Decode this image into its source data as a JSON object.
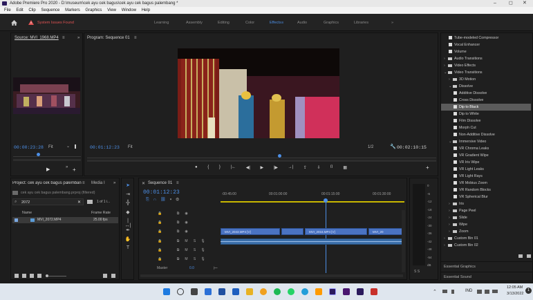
{
  "window": {
    "title": "Adobe Premiere Pro 2020 - D:\\museum\\cek ayu cek bagus\\cek ayu cek bagus palembang *",
    "controls": [
      "–",
      "◻",
      "✕"
    ]
  },
  "menu": [
    "File",
    "Edit",
    "Clip",
    "Sequence",
    "Markers",
    "Graphics",
    "View",
    "Window",
    "Help"
  ],
  "workspaces": [
    "Learning",
    "Assembly",
    "Editing",
    "Color",
    "Effects",
    "Audio",
    "Graphics",
    "Libraries"
  ],
  "workspace_active": "Effects",
  "workspace_more": "»",
  "issues_label": "System Issues Found",
  "source": {
    "tab": "Source: MVI_1968.MP4",
    "menu": "≡",
    "more": "»",
    "timecode": "00:00:23:28",
    "fit": "Fit",
    "fit_arrow": "⌄"
  },
  "program": {
    "tab": "Program: Sequence 01",
    "menu": "≡",
    "timecode": "00:01:12:23",
    "fit": "Fit",
    "fraction": "1/2",
    "duration": "00:02:10:15",
    "wrench": "🔧"
  },
  "program_controls": [
    "●",
    "{",
    "}",
    "|←",
    "◀|",
    "▶",
    "|▶",
    "→|",
    "⇪",
    "⇩",
    "⌷",
    "▦"
  ],
  "source_controls": [
    "▶",
    "»",
    "+"
  ],
  "program_plus": "+",
  "project": {
    "tab": "Project: cek ayu cek bagus palembang",
    "tab_menu": "≡",
    "media_tab": "Media I",
    "more": "»",
    "file": "cek ayu cek bagus palembang.prproj (filtered)",
    "search": "2072",
    "count": "1 of 1 i...",
    "col_name": "Name",
    "col_rate": "Frame Rate",
    "item_name": "MVI_2072.MP4",
    "item_rate": "25.00 fps"
  },
  "timeline": {
    "close": "✕",
    "tab": "Sequence 01",
    "menu": "≡",
    "timecode": "00:01:12:23",
    "ruler": [
      ":00:45:00",
      "00:01:00:00",
      "00:01:15:00",
      "00:01:30:00"
    ],
    "tracks_v": [
      {
        "lock": "🔒",
        "src": "",
        "name": "V3"
      },
      {
        "lock": "🔒",
        "src": "",
        "name": "V2"
      },
      {
        "lock": "🔒",
        "src": "V1",
        "name": "V1"
      }
    ],
    "tracks_a": [
      {
        "lock": "🔒",
        "src": "",
        "name": "A1",
        "m": "M",
        "s": "S"
      },
      {
        "lock": "🔒",
        "src": "",
        "name": "A2",
        "m": "M",
        "s": "S"
      },
      {
        "lock": "🔒",
        "src": "",
        "name": "A3",
        "m": "M",
        "s": "S"
      }
    ],
    "master_label": "Master",
    "master_value": "0.0",
    "clips": [
      "MVI_2043.MP4 [V]",
      "",
      "MVI_2016.MP4 [V]",
      "MVI_20"
    ]
  },
  "meter_scale": [
    "0",
    "-6",
    "-12",
    "-18",
    "-24",
    "-30",
    "-36",
    "-42",
    "-48",
    "-54",
    "dB"
  ],
  "meter_bottom": "S  S",
  "effects": [
    {
      "t": "item",
      "label": "Tube-modeled Compressor",
      "indent": 1
    },
    {
      "t": "item",
      "label": "Vocal Enhancer",
      "indent": 1
    },
    {
      "t": "item",
      "label": "Volume",
      "indent": 1
    },
    {
      "t": "folder",
      "label": "Audio Transitions",
      "indent": 0
    },
    {
      "t": "folder",
      "label": "Video Effects",
      "indent": 0
    },
    {
      "t": "folderopen",
      "label": "Video Transitions",
      "indent": 0
    },
    {
      "t": "folder",
      "label": "3D Motion",
      "indent": 1
    },
    {
      "t": "folderopen",
      "label": "Dissolve",
      "indent": 1
    },
    {
      "t": "item",
      "label": "Additive Dissolve",
      "indent": 2
    },
    {
      "t": "item",
      "label": "Cross Dissolve",
      "indent": 2
    },
    {
      "t": "item",
      "label": "Dip to Black",
      "indent": 2,
      "sel": true
    },
    {
      "t": "item",
      "label": "Dip to White",
      "indent": 2
    },
    {
      "t": "item",
      "label": "Film Dissolve",
      "indent": 2
    },
    {
      "t": "item",
      "label": "Morph Cut",
      "indent": 2
    },
    {
      "t": "item",
      "label": "Non-Additive Dissolve",
      "indent": 2
    },
    {
      "t": "folderopen",
      "label": "Immersive Video",
      "indent": 1
    },
    {
      "t": "item",
      "label": "VR Chroma Leaks",
      "indent": 2
    },
    {
      "t": "item",
      "label": "VR Gradient Wipe",
      "indent": 2
    },
    {
      "t": "item",
      "label": "VR Iris Wipe",
      "indent": 2
    },
    {
      "t": "item",
      "label": "VR Light Leaks",
      "indent": 2
    },
    {
      "t": "item",
      "label": "VR Light Rays",
      "indent": 2
    },
    {
      "t": "item",
      "label": "VR Mobius Zoom",
      "indent": 2
    },
    {
      "t": "item",
      "label": "VR Random Blocks",
      "indent": 2
    },
    {
      "t": "item",
      "label": "VR Spherical Blur",
      "indent": 2
    },
    {
      "t": "folder",
      "label": "Iris",
      "indent": 1
    },
    {
      "t": "folder",
      "label": "Page Peel",
      "indent": 1
    },
    {
      "t": "folder",
      "label": "Slide",
      "indent": 1
    },
    {
      "t": "folder",
      "label": "Wipe",
      "indent": 1
    },
    {
      "t": "folder",
      "label": "Zoom",
      "indent": 1
    },
    {
      "t": "folder",
      "label": "Custom Bin 01",
      "indent": 0
    },
    {
      "t": "folder",
      "label": "Custom Bin 02",
      "indent": 0
    }
  ],
  "essential_graphics": "Essential Graphics",
  "essential_sound": "Essential Sound",
  "taskbar": {
    "lang": "IND",
    "time": "12:05 AM",
    "date": "3/13/2022",
    "notif": "1"
  },
  "colors": {
    "accent": "#4d8fe6",
    "clip": "#4a73c2",
    "selected": "#5b5b5b"
  }
}
